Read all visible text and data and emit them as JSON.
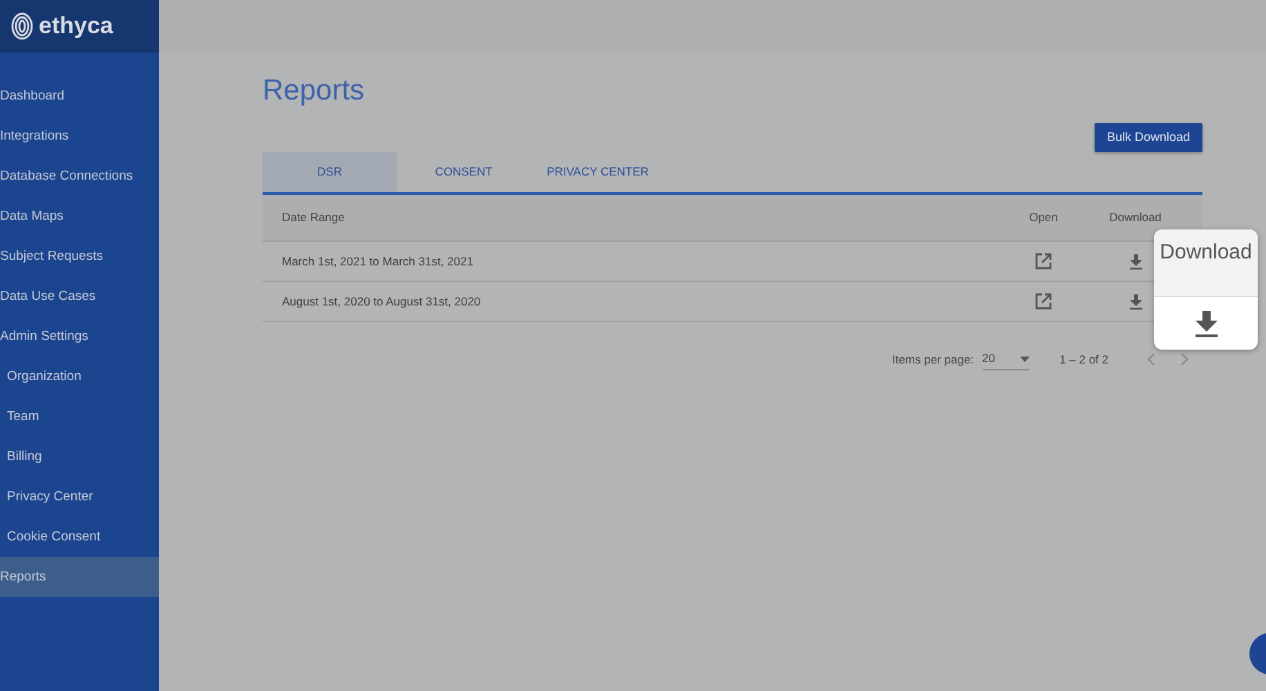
{
  "logo": {
    "text": "ethyca"
  },
  "sidebar": {
    "items": [
      {
        "label": "Dashboard",
        "selected": false
      },
      {
        "label": "Integrations",
        "selected": false
      },
      {
        "label": "Database Connections",
        "selected": false
      },
      {
        "label": "Data Maps",
        "selected": false
      },
      {
        "label": "Subject Requests",
        "selected": false
      },
      {
        "label": "Data Use Cases",
        "selected": false
      },
      {
        "label": "Admin Settings",
        "selected": false,
        "children": [
          {
            "label": "Organization",
            "selected": false
          },
          {
            "label": "Team",
            "selected": false
          },
          {
            "label": "Billing",
            "selected": false
          },
          {
            "label": "Privacy Center",
            "selected": false
          },
          {
            "label": "Cookie Consent",
            "selected": false
          }
        ]
      },
      {
        "label": "Reports",
        "selected": true
      }
    ]
  },
  "page": {
    "title": "Reports",
    "bulk_button": "Bulk Download"
  },
  "tabs": [
    {
      "label": "DSR",
      "selected": true
    },
    {
      "label": "CONSENT",
      "selected": false
    },
    {
      "label": "PRIVACY CENTER",
      "selected": false
    }
  ],
  "table": {
    "columns": [
      "Date Range",
      "Open",
      "Download"
    ],
    "rows": [
      {
        "date_range": "March 1st, 2021 to March 31st, 2021"
      },
      {
        "date_range": "August 1st, 2020 to August 31st, 2020"
      }
    ]
  },
  "pagination": {
    "label": "Items per page:",
    "page_size": "20",
    "range": "1 – 2 of 2"
  },
  "callout": {
    "title": "Download"
  }
}
